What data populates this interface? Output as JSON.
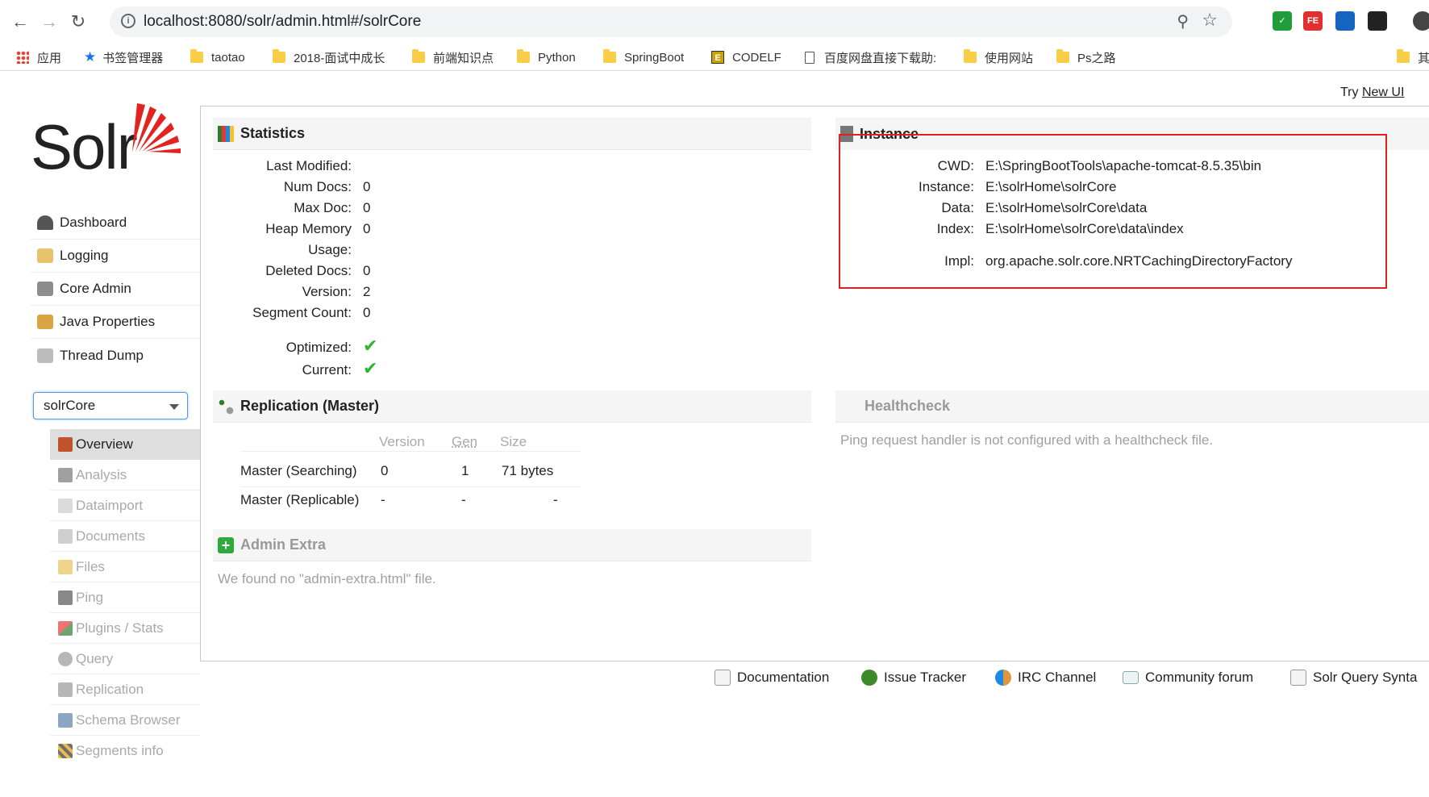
{
  "browser": {
    "url": "localhost:8080/solr/admin.html#/solrCore",
    "bookmarks": [
      {
        "label": "应用",
        "icon": "apps-grid-icon"
      },
      {
        "label": "书签管理器",
        "icon": "star-icon"
      },
      {
        "label": "taotao",
        "icon": "folder-icon"
      },
      {
        "label": "2018-面试中成长",
        "icon": "folder-icon"
      },
      {
        "label": "前端知识点",
        "icon": "folder-icon"
      },
      {
        "label": "Python",
        "icon": "folder-icon"
      },
      {
        "label": "SpringBoot",
        "icon": "folder-icon"
      },
      {
        "label": "CODELF",
        "icon": "codelf-icon"
      },
      {
        "label": "百度网盘直接下载助:",
        "icon": "page-icon"
      },
      {
        "label": "使用网站",
        "icon": "folder-icon"
      },
      {
        "label": "Ps之路",
        "icon": "folder-icon"
      },
      {
        "label": "其",
        "icon": "folder-icon"
      }
    ],
    "ext_fe": "FE"
  },
  "try_ui": {
    "prefix": "Try",
    "link": "New UI"
  },
  "logo": {
    "text": "Solr"
  },
  "sidebar": [
    {
      "label": "Dashboard",
      "icon": "dashboard-icon"
    },
    {
      "label": "Logging",
      "icon": "logging-icon"
    },
    {
      "label": "Core Admin",
      "icon": "core-admin-icon"
    },
    {
      "label": "Java Properties",
      "icon": "java-properties-icon"
    },
    {
      "label": "Thread Dump",
      "icon": "thread-dump-icon"
    }
  ],
  "core_selector": {
    "value": "solrCore"
  },
  "core_menu": [
    {
      "label": "Overview",
      "icon": "home-icon"
    },
    {
      "label": "Analysis",
      "icon": "funnel-icon"
    },
    {
      "label": "Dataimport",
      "icon": "dataimport-icon"
    },
    {
      "label": "Documents",
      "icon": "documents-icon"
    },
    {
      "label": "Files",
      "icon": "files-icon"
    },
    {
      "label": "Ping",
      "icon": "ping-icon"
    },
    {
      "label": "Plugins / Stats",
      "icon": "plugins-icon"
    },
    {
      "label": "Query",
      "icon": "query-icon"
    },
    {
      "label": "Replication",
      "icon": "replication-icon"
    },
    {
      "label": "Schema Browser",
      "icon": "schema-icon"
    },
    {
      "label": "Segments info",
      "icon": "segments-icon"
    }
  ],
  "statistics": {
    "title": "Statistics",
    "rows": [
      {
        "k": "Last Modified:",
        "v": ""
      },
      {
        "k": "Num Docs:",
        "v": "0"
      },
      {
        "k": "Max Doc:",
        "v": "0"
      },
      {
        "k": "Heap Memory",
        "v": "0"
      },
      {
        "k": "Usage:",
        "v": ""
      },
      {
        "k": "Deleted Docs:",
        "v": "0"
      },
      {
        "k": "Version:",
        "v": "2"
      },
      {
        "k": "Segment Count:",
        "v": "0"
      }
    ],
    "optimized_label": "Optimized:",
    "current_label": "Current:"
  },
  "instance": {
    "title": "Instance",
    "rows": [
      {
        "k": "CWD:",
        "v": "E:\\SpringBootTools\\apache-tomcat-8.5.35\\bin"
      },
      {
        "k": "Instance:",
        "v": "E:\\solrHome\\solrCore"
      },
      {
        "k": "Data:",
        "v": "E:\\solrHome\\solrCore\\data"
      },
      {
        "k": "Index:",
        "v": "E:\\solrHome\\solrCore\\data\\index"
      },
      {
        "k": "Impl:",
        "v": "org.apache.solr.core.NRTCachingDirectoryFactory"
      }
    ]
  },
  "replication": {
    "title": "Replication (Master)",
    "headers": [
      "Version",
      "Gen",
      "Size"
    ],
    "rows": [
      {
        "name": "Master (Searching)",
        "version": "0",
        "gen": "1",
        "size": "71 bytes"
      },
      {
        "name": "Master (Replicable)",
        "version": "-",
        "gen": "-",
        "size": "-"
      }
    ]
  },
  "healthcheck": {
    "title": "Healthcheck",
    "message": "Ping request handler is not configured with a healthcheck file."
  },
  "admin_extra": {
    "title": "Admin Extra",
    "message": "We found no \"admin-extra.html\" file."
  },
  "footer": [
    {
      "label": "Documentation",
      "icon": "documentation-icon"
    },
    {
      "label": "Issue Tracker",
      "icon": "bug-icon"
    },
    {
      "label": "IRC Channel",
      "icon": "irc-icon"
    },
    {
      "label": "Community forum",
      "icon": "mail-icon"
    },
    {
      "label": "Solr Query Synta",
      "icon": "query-syntax-icon"
    }
  ]
}
